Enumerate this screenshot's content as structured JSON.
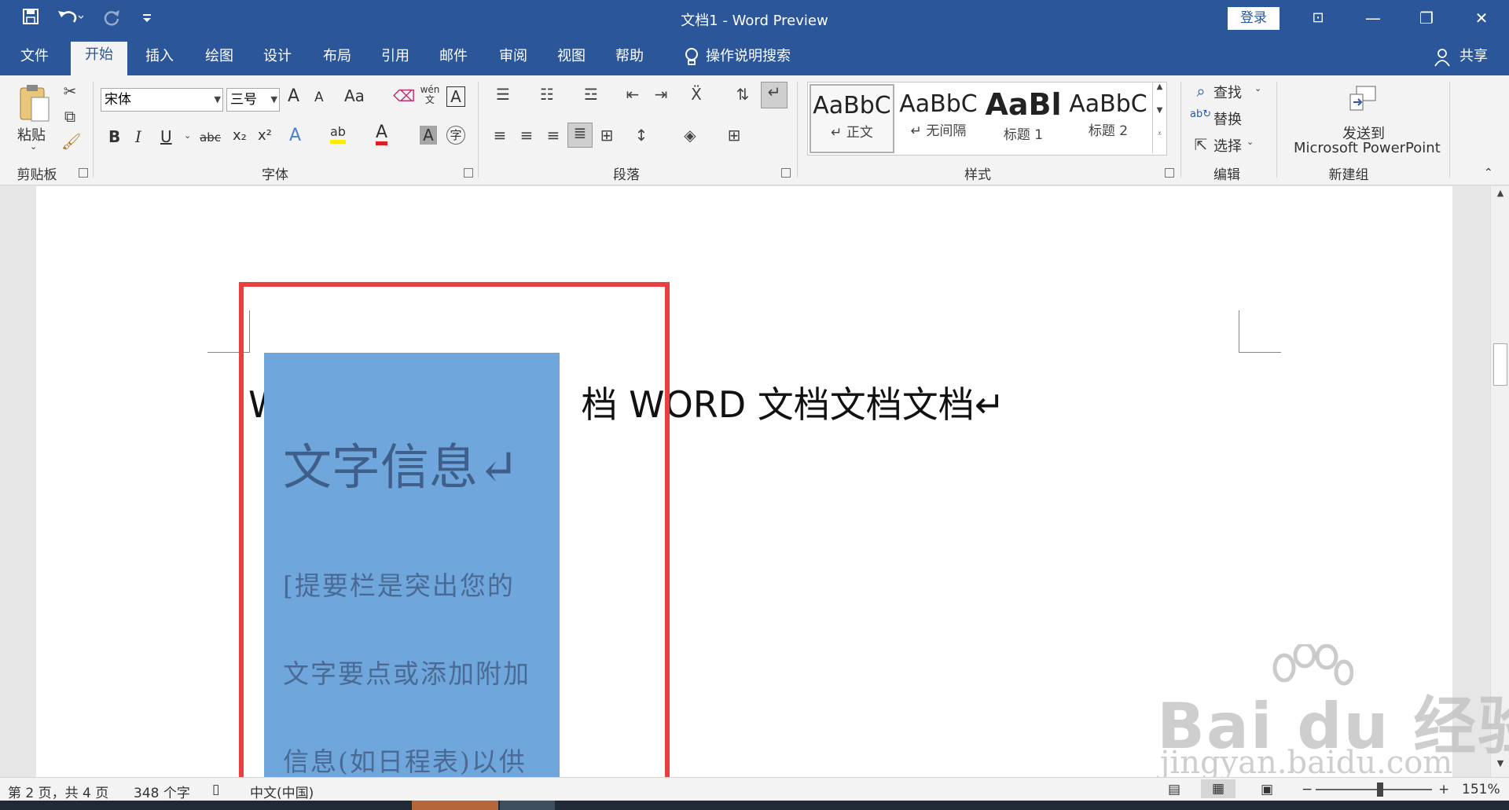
{
  "window": {
    "title": "文档1  -  Word Preview",
    "login_label": "登录",
    "minimize_glyph": "—",
    "restore_glyph": "❐",
    "close_glyph": "✕",
    "ribbon_display_glyph": "⊡"
  },
  "qat": {
    "save_icon": "save-icon",
    "undo_icon": "undo-icon",
    "redo_icon": "redo-icon",
    "customize_icon": "customize-qat-icon"
  },
  "tabs": [
    {
      "label": "文件"
    },
    {
      "label": "开始"
    },
    {
      "label": "插入"
    },
    {
      "label": "绘图"
    },
    {
      "label": "设计"
    },
    {
      "label": "布局"
    },
    {
      "label": "引用"
    },
    {
      "label": "邮件"
    },
    {
      "label": "审阅"
    },
    {
      "label": "视图"
    },
    {
      "label": "帮助"
    }
  ],
  "active_tab": "开始",
  "tell_me": {
    "label": "操作说明搜索"
  },
  "share": {
    "label": "共享"
  },
  "clipboard": {
    "paste_label": "粘贴",
    "group_label": "剪贴板"
  },
  "font": {
    "name": "宋体",
    "size": "三号",
    "group_label": "字体",
    "bold": "B",
    "italic": "I",
    "underline": "U",
    "strike": "abc",
    "subscript": "x₂",
    "superscript": "x²",
    "grow": "A",
    "shrink": "A",
    "change_case": "Aa",
    "phonetic": "wén 文",
    "char_border": "A",
    "text_effects": "A",
    "highlight": "ab",
    "font_color": "A",
    "char_shading": "A",
    "enclose": "字"
  },
  "paragraph": {
    "group_label": "段落"
  },
  "styles": {
    "group_label": "样式",
    "items": [
      {
        "sample": "AaBbC",
        "name": "↵ 正文"
      },
      {
        "sample": "AaBbC",
        "name": "↵ 无间隔"
      },
      {
        "sample": "AaBl",
        "name": "标题 1"
      },
      {
        "sample": "AaBbC",
        "name": "标题 2"
      }
    ]
  },
  "editing": {
    "find": "查找",
    "replace": "替换",
    "select": "选择",
    "group_label": "编辑"
  },
  "new_group": {
    "send_line1": "发送到",
    "send_line2": "Microsoft PowerPoint",
    "group_label": "新建组"
  },
  "document": {
    "body_line_start": "W",
    "body_line_end": "档 WORD 文档文档文档↵",
    "sidebar_title": "文字信息↵",
    "sidebar_lines": [
      "[提要栏是突出您的",
      "文字要点或添加附加",
      "信息(如日程表)以供"
    ]
  },
  "status": {
    "page": "第 2 页，共 4 页",
    "words": "348 个字",
    "language": "中文(中国)",
    "zoom": "151%",
    "zoom_minus": "−",
    "zoom_plus": "+"
  },
  "watermark": {
    "main": "Bai du 经验",
    "sub": "jingyan.baidu.com"
  },
  "colors": {
    "title_bar": "#2b579a",
    "ribbon": "#f3f3f3",
    "sidebar_fill": "#6fa6dc",
    "highlight_box": "#ea3f3f"
  }
}
